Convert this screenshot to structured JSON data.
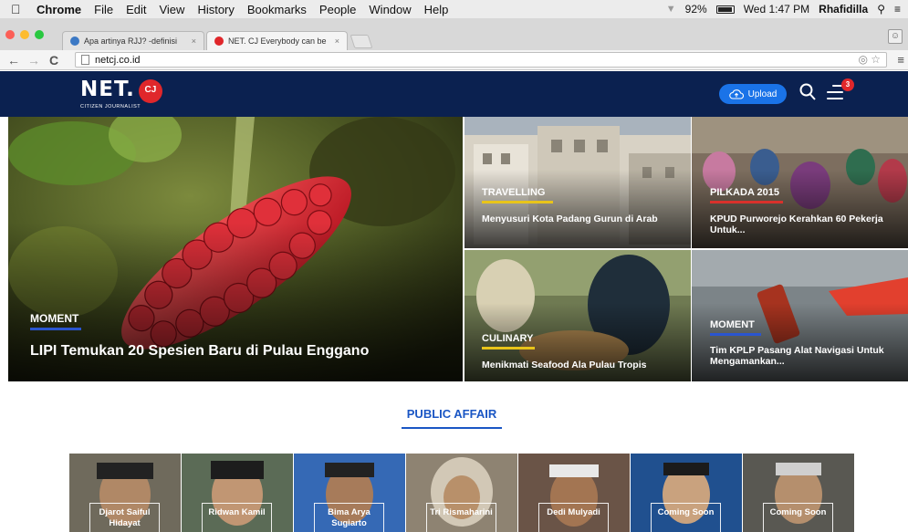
{
  "mac_menu": {
    "app": "Chrome",
    "items": [
      "File",
      "Edit",
      "View",
      "History",
      "Bookmarks",
      "People",
      "Window",
      "Help"
    ],
    "battery": "92%",
    "clock": "Wed 1:47 PM",
    "user": "Rhafidilla"
  },
  "tabs": [
    {
      "title": "Apa artinya RJJ? -definisi",
      "close": "×"
    },
    {
      "title": "NET. CJ Everybody can be",
      "close": "×"
    }
  ],
  "address": {
    "url": "netcj.co.id"
  },
  "site": {
    "logo_text": "NET.",
    "logo_sub": "CITIZEN JOURNALIST",
    "upload_label": "Upload",
    "notification_count": "3",
    "colors": {
      "header": "#0b2150",
      "accent_blue": "#1a73e8",
      "badge_red": "#e0272b"
    }
  },
  "hero": {
    "main": {
      "category": "MOMENT",
      "headline": "LIPI Temukan 20 Spesien Baru di Pulau Enggano"
    },
    "tiles": [
      {
        "category": "TRAVELLING",
        "headline": "Menyusuri Kota Padang Gurun di Arab",
        "underline": "#e8c41a"
      },
      {
        "category": "PILKADA 2015",
        "headline": "KPUD Purworejo Kerahkan 60 Pekerja Untuk...",
        "underline": "#d9312b"
      },
      {
        "category": "CULINARY",
        "headline": "Menikmati Seafood Ala Pulau Tropis",
        "underline": "#e8c41a"
      },
      {
        "category": "MOMENT",
        "headline": "Tim KPLP Pasang Alat Navigasi Untuk Mengamankan...",
        "underline": "#2a55d0"
      }
    ]
  },
  "section": {
    "title": "PUBLIC AFFAIR"
  },
  "people": [
    {
      "name": "Djarot Saiful Hidayat"
    },
    {
      "name": "Ridwan Kamil"
    },
    {
      "name": "Bima Arya Sugiarto"
    },
    {
      "name": "Tri Rismaharini"
    },
    {
      "name": "Dedi Mulyadi"
    },
    {
      "name": "Coming Soon"
    },
    {
      "name": "Coming Soon"
    }
  ]
}
